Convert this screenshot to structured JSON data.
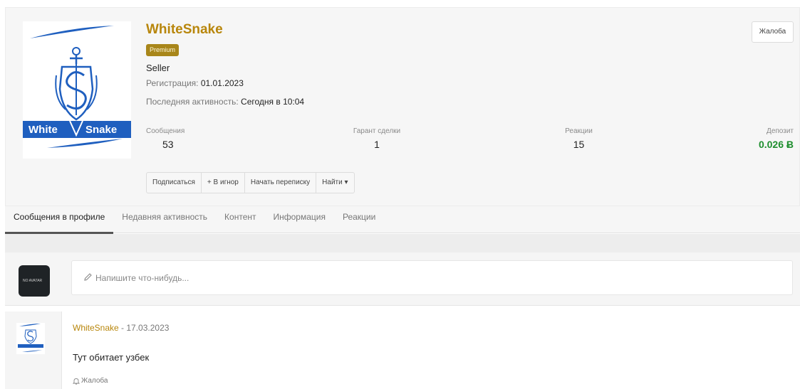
{
  "profile": {
    "username": "WhiteSnake",
    "badge": "Premium",
    "user_title": "Seller",
    "registration_label": "Регистрация:",
    "registration_value": "01.01.2023",
    "last_activity_label": "Последняя активность:",
    "last_activity_value": "Сегодня в 10:04",
    "complaint_button": "Жалоба",
    "avatar_text_left": "White",
    "avatar_text_right": "Snake"
  },
  "stats": [
    {
      "label": "Сообщения",
      "value": "53"
    },
    {
      "label": "Гарант сделки",
      "value": "1"
    },
    {
      "label": "Реакции",
      "value": "15"
    },
    {
      "label": "Депозит",
      "value": "0.026 Ƀ"
    }
  ],
  "actions": [
    "Подписаться",
    "+ В игнор",
    "Начать переписку",
    "Найти ▾"
  ],
  "tabs": [
    "Сообщения в профиле",
    "Недавняя активность",
    "Контент",
    "Информация",
    "Реакции"
  ],
  "composer": {
    "placeholder": "Напишите что-нибудь...",
    "avatar_text": "NO AVATAR"
  },
  "post": {
    "author": "WhiteSnake",
    "date": " - 17.03.2023",
    "text": "Тут обитает узбек",
    "report_label": "Жалоба"
  },
  "colors": {
    "username": "#b8860b",
    "badge": "#a8861a",
    "deposit": "#1e8e2e",
    "logo_blue": "#1f5fbf"
  }
}
